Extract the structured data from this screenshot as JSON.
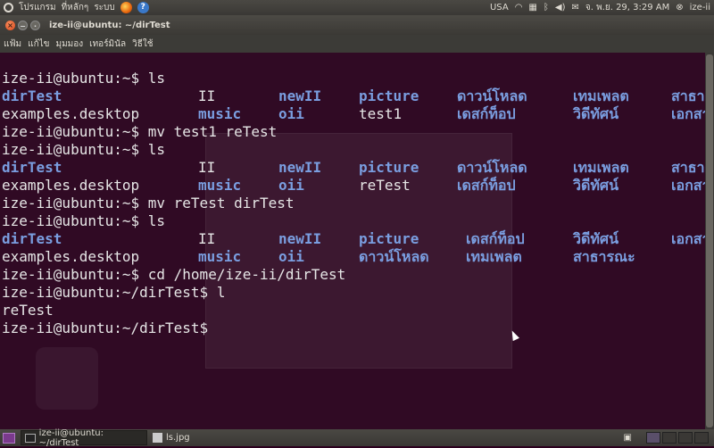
{
  "top_panel": {
    "menu_applications": "โปรแกรม",
    "menu_places": "ที่หลักๆ",
    "menu_system": "ระบบ",
    "keyboard_layout": "USA",
    "datetime": "จ. พ.ย. 29,  3:29 AM",
    "user": "ize-ii"
  },
  "window": {
    "title": "ize-ii@ubuntu: ~/dirTest",
    "menus": [
      "แฟ้ม",
      "แก้ไข",
      "มุมมอง",
      "เทอร์มินัล",
      "วิธีใช้"
    ]
  },
  "terminal": {
    "lines": [
      [
        {
          "t": "ize-ii@ubuntu:~$ ls",
          "c": 0,
          "k": "p"
        }
      ],
      [
        {
          "t": "dirTest",
          "c": 0,
          "k": "d"
        },
        {
          "t": "II",
          "c": 22,
          "k": "n"
        },
        {
          "t": "newII",
          "c": 31,
          "k": "d"
        },
        {
          "t": "picture",
          "c": 40,
          "k": "d"
        },
        {
          "t": "ดาวน์โหลด",
          "c": 51,
          "k": "d"
        },
        {
          "t": "เทมเพลต",
          "c": 64,
          "k": "d"
        },
        {
          "t": "สาธารณะ",
          "c": 75,
          "k": "d"
        }
      ],
      [
        {
          "t": "examples.desktop",
          "c": 0,
          "k": "n"
        },
        {
          "t": "music",
          "c": 22,
          "k": "d"
        },
        {
          "t": "oii",
          "c": 31,
          "k": "d"
        },
        {
          "t": "test1",
          "c": 40,
          "k": "n"
        },
        {
          "t": "เดสก์ท็อป",
          "c": 51,
          "k": "d"
        },
        {
          "t": "วิดีทัศน์",
          "c": 64,
          "k": "d"
        },
        {
          "t": "เอกสาร",
          "c": 75,
          "k": "d"
        }
      ],
      [
        {
          "t": "ize-ii@ubuntu:~$ mv test1 reTest",
          "c": 0,
          "k": "p"
        }
      ],
      [
        {
          "t": "ize-ii@ubuntu:~$ ls",
          "c": 0,
          "k": "p"
        }
      ],
      [
        {
          "t": "dirTest",
          "c": 0,
          "k": "d"
        },
        {
          "t": "II",
          "c": 22,
          "k": "n"
        },
        {
          "t": "newII",
          "c": 31,
          "k": "d"
        },
        {
          "t": "picture",
          "c": 40,
          "k": "d"
        },
        {
          "t": "ดาวน์โหลด",
          "c": 51,
          "k": "d"
        },
        {
          "t": "เทมเพลต",
          "c": 64,
          "k": "d"
        },
        {
          "t": "สาธารณะ",
          "c": 75,
          "k": "d"
        }
      ],
      [
        {
          "t": "examples.desktop",
          "c": 0,
          "k": "n"
        },
        {
          "t": "music",
          "c": 22,
          "k": "d"
        },
        {
          "t": "oii",
          "c": 31,
          "k": "d"
        },
        {
          "t": "reTest",
          "c": 40,
          "k": "n"
        },
        {
          "t": "เดสก์ท็อป",
          "c": 51,
          "k": "d"
        },
        {
          "t": "วิดีทัศน์",
          "c": 64,
          "k": "d"
        },
        {
          "t": "เอกสาร",
          "c": 75,
          "k": "d"
        }
      ],
      [
        {
          "t": "ize-ii@ubuntu:~$ mv reTest dirTest",
          "c": 0,
          "k": "p"
        }
      ],
      [
        {
          "t": "ize-ii@ubuntu:~$ ls",
          "c": 0,
          "k": "p"
        }
      ],
      [
        {
          "t": "dirTest",
          "c": 0,
          "k": "d"
        },
        {
          "t": "II",
          "c": 22,
          "k": "n"
        },
        {
          "t": "newII",
          "c": 31,
          "k": "d"
        },
        {
          "t": "picture",
          "c": 40,
          "k": "d"
        },
        {
          "t": "เดสก์ท็อป",
          "c": 52,
          "k": "d"
        },
        {
          "t": "วิดีทัศน์",
          "c": 64,
          "k": "d"
        },
        {
          "t": "เอกสาร",
          "c": 75,
          "k": "d"
        }
      ],
      [
        {
          "t": "examples.desktop",
          "c": 0,
          "k": "n"
        },
        {
          "t": "music",
          "c": 22,
          "k": "d"
        },
        {
          "t": "oii",
          "c": 31,
          "k": "d"
        },
        {
          "t": "ดาวน์โหลด",
          "c": 40,
          "k": "d"
        },
        {
          "t": "เทมเพลต",
          "c": 52,
          "k": "d"
        },
        {
          "t": "สาธารณะ",
          "c": 64,
          "k": "d"
        }
      ],
      [
        {
          "t": "ize-ii@ubuntu:~$ cd /home/ize-ii/dirTest",
          "c": 0,
          "k": "p"
        }
      ],
      [
        {
          "t": "ize-ii@ubuntu:~/dirTest$ l",
          "c": 0,
          "k": "p"
        }
      ],
      [
        {
          "t": "reTest",
          "c": 0,
          "k": "n"
        }
      ],
      [
        {
          "t": "ize-ii@ubuntu:~/dirTest$",
          "c": 0,
          "k": "p"
        }
      ]
    ]
  },
  "taskbar": {
    "tasks": [
      "ize-ii@ubuntu: ~/dirTest",
      "ls.jpg"
    ]
  },
  "colors": {
    "terminal_bg": "#300a24",
    "directory": "#7a9ee0",
    "text": "#e6e6e6"
  }
}
